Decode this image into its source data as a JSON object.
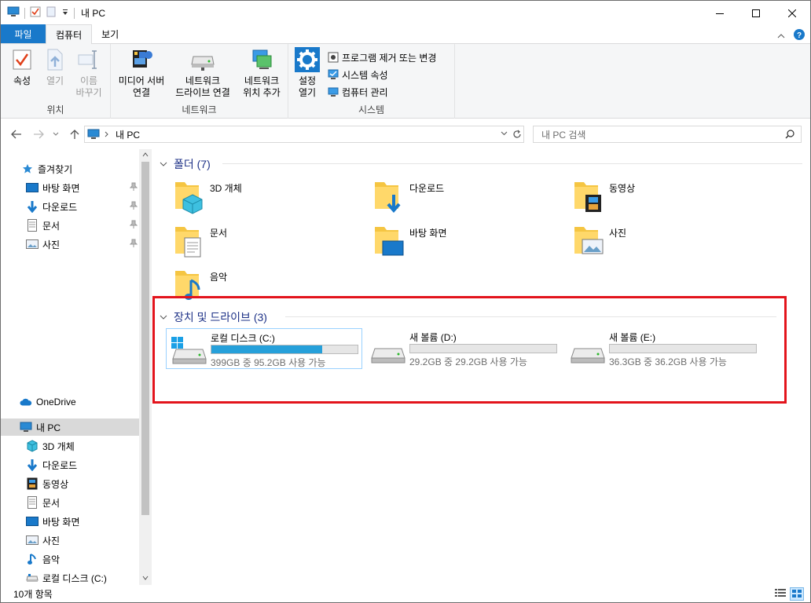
{
  "window": {
    "title": "내 PC"
  },
  "tabs": {
    "file": "파일",
    "computer": "컴퓨터",
    "view": "보기"
  },
  "ribbon": {
    "location_group": "위치",
    "properties": "속성",
    "open": "열기",
    "rename": "이름\n바꾸기",
    "network_group": "네트워크",
    "media_server": "미디어 서버\n연결",
    "map_drive": "네트워크\n드라이브 연결",
    "network_location": "네트워크\n위치 추가",
    "system_group": "시스템",
    "open_settings": "설정\n열기",
    "uninstall": "프로그램 제거 또는 변경",
    "system_properties": "시스템 속성",
    "manage": "컴퓨터 관리"
  },
  "address": {
    "path": "내 PC",
    "search_placeholder": "내 PC 검색"
  },
  "navpane": {
    "quick_access": "즐겨찾기",
    "qa_items": [
      "바탕 화면",
      "다운로드",
      "문서",
      "사진"
    ],
    "onedrive": "OneDrive",
    "this_pc": "내 PC",
    "pc_items": [
      "3D 개체",
      "다운로드",
      "동영상",
      "문서",
      "바탕 화면",
      "사진",
      "음악",
      "로컬 디스크 (C:)"
    ]
  },
  "folders": {
    "header": "폴더 (7)",
    "items": [
      "3D 개체",
      "다운로드",
      "동영상",
      "문서",
      "바탕 화면",
      "사진",
      "음악"
    ]
  },
  "drives": {
    "header": "장치 및 드라이브 (3)",
    "items": [
      {
        "name": "로컬 디스크 (C:)",
        "size": "399GB 중 95.2GB 사용 가능",
        "used_fraction": 0.76
      },
      {
        "name": "새 볼륨 (D:)",
        "size": "29.2GB 중 29.2GB 사용 가능",
        "used_fraction": 0.0
      },
      {
        "name": "새 볼륨 (E:)",
        "size": "36.3GB 중 36.2GB 사용 가능",
        "used_fraction": 0.0
      }
    ]
  },
  "status": {
    "count": "10개 항목"
  },
  "colors": {
    "accent": "#1979ca",
    "header_text": "#1e3287",
    "drive_bar": "#26a0da",
    "highlight_box": "#e3141c"
  }
}
